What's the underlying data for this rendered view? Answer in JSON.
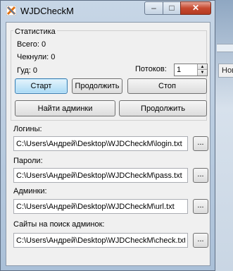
{
  "window": {
    "title": "WJDCheckM",
    "close_glyph": "✕",
    "minimize_glyph": "–",
    "maximize_glyph": "□"
  },
  "desktop": {
    "partial_tab": "Нов"
  },
  "stats": {
    "group_title": "Статистика",
    "total": "Всего: 0",
    "checked": "Чекнули: 0",
    "good": "Гуд: 0",
    "threads_label": "Потоков:",
    "threads_value": "1"
  },
  "buttons": {
    "start": "Старт",
    "continue": "Продолжить",
    "stop": "Стоп",
    "find_admins": "Найти админки",
    "continue2": "Продолжить",
    "browse": "..."
  },
  "fields": [
    {
      "label": "Логины:",
      "value": "C:\\Users\\Андрей\\Desktop\\WJDCheckM\\login.txt"
    },
    {
      "label": "Пароли:",
      "value": "C:\\Users\\Андрей\\Desktop\\WJDCheckM\\pass.txt"
    },
    {
      "label": "Админки:",
      "value": "C:\\Users\\Андрей\\Desktop\\WJDCheckM\\url.txt"
    },
    {
      "label": "Сайты на поиск админок:",
      "value": "C:\\Users\\Андрей\\Desktop\\WJDCheckM\\check.txt"
    }
  ]
}
